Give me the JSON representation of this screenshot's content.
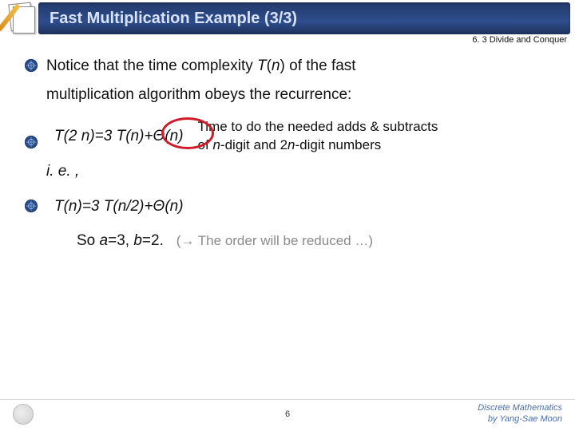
{
  "header": {
    "title": "Fast Multiplication Example (3/3)",
    "section": "6. 3 Divide and Conquer"
  },
  "body": {
    "intro_l1_pre": "Notice that the time complexity ",
    "intro_l1_fn": "T",
    "intro_l1_paren_open": "(",
    "intro_l1_arg": "n",
    "intro_l1_paren_close": ") of the fast",
    "intro_l2": "multiplication algorithm obeys the recurrence:",
    "eq1": "T(2 n)=3 T(n)+Θ(n)",
    "note_l1": "Time to do the needed adds & subtracts",
    "note_l2_pre": "of ",
    "note_l2_var1": "n",
    "note_l2_mid": "-digit and 2",
    "note_l2_var2": "n",
    "note_l2_post": "-digit numbers",
    "ie": "i. e. ,",
    "eq2": "T(n)=3 T(n/2)+Θ(n)",
    "so_pre": "So ",
    "so_a": "a",
    "so_aval": "=3, ",
    "so_b": "b",
    "so_bval": "=2.",
    "reduce": "(→ The order will be reduced …)"
  },
  "footer": {
    "page": "6",
    "course_l1": "Discrete Mathematics",
    "course_l2": "by Yang-Sae Moon"
  }
}
